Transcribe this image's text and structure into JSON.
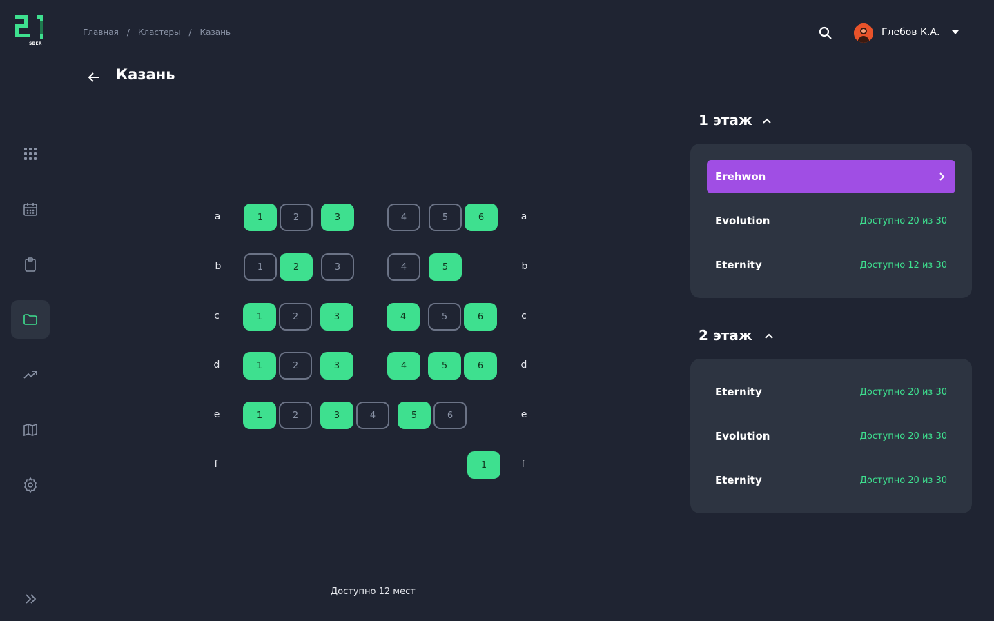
{
  "logo": {
    "sub": "SBER"
  },
  "breadcrumb": {
    "home": "Главная",
    "clusters": "Кластеры",
    "current": "Казань",
    "separator": "/"
  },
  "user": {
    "name": "Глебов К.А."
  },
  "page": {
    "title": "Казань"
  },
  "seatmap": {
    "rows": [
      {
        "label": "a",
        "seats": [
          {
            "n": "1",
            "state": "free"
          },
          {
            "n": "2",
            "state": "busy"
          },
          {
            "n": "3",
            "state": "free"
          },
          {
            "n": "4",
            "state": "busy"
          },
          {
            "n": "5",
            "state": "busy"
          },
          {
            "n": "6",
            "state": "free"
          }
        ]
      },
      {
        "label": "b",
        "seats": [
          {
            "n": "1",
            "state": "busy"
          },
          {
            "n": "2",
            "state": "free"
          },
          {
            "n": "3",
            "state": "busy"
          },
          {
            "n": "4",
            "state": "busy"
          },
          {
            "n": "5",
            "state": "free"
          }
        ]
      },
      {
        "label": "c",
        "seats": [
          {
            "n": "1",
            "state": "free"
          },
          {
            "n": "2",
            "state": "busy"
          },
          {
            "n": "3",
            "state": "free"
          },
          {
            "n": "4",
            "state": "free"
          },
          {
            "n": "5",
            "state": "busy"
          },
          {
            "n": "6",
            "state": "free"
          }
        ]
      },
      {
        "label": "d",
        "seats": [
          {
            "n": "1",
            "state": "free"
          },
          {
            "n": "2",
            "state": "busy"
          },
          {
            "n": "3",
            "state": "free"
          },
          {
            "n": "4",
            "state": "free"
          },
          {
            "n": "5",
            "state": "free"
          },
          {
            "n": "6",
            "state": "free"
          }
        ]
      },
      {
        "label": "e",
        "seats": [
          {
            "n": "1",
            "state": "free"
          },
          {
            "n": "2",
            "state": "busy"
          },
          {
            "n": "3",
            "state": "free"
          },
          {
            "n": "4",
            "state": "busy"
          },
          {
            "n": "5",
            "state": "free"
          },
          {
            "n": "6",
            "state": "busy"
          }
        ]
      },
      {
        "label": "f",
        "seats": [
          {
            "n": "1",
            "state": "free"
          }
        ]
      }
    ],
    "available": "Доступно 12 мест"
  },
  "floors": [
    {
      "title": "1 этаж",
      "clusters": [
        {
          "name": "Erehwon",
          "avail": "",
          "selected": true
        },
        {
          "name": "Evolution",
          "avail": "Доступно 20 из 30",
          "selected": false
        },
        {
          "name": "Eternity",
          "avail": "Доступно 12 из 30",
          "selected": false
        }
      ]
    },
    {
      "title": "2 этаж",
      "clusters": [
        {
          "name": "Eternity",
          "avail": "Доступно 20 из 30",
          "selected": false
        },
        {
          "name": "Evolution",
          "avail": "Доступно 20 из 30",
          "selected": false
        },
        {
          "name": "Eternity",
          "avail": "Доступно 20 из 30",
          "selected": false
        }
      ]
    }
  ],
  "colors": {
    "accent": "#3ee08f",
    "selected": "#a04ee4",
    "background": "#1f2432",
    "card": "#2d3441"
  },
  "icons": {
    "sidebar": [
      "grid-icon",
      "calendar-icon",
      "clipboard-icon",
      "folder-icon",
      "trending-icon",
      "map-icon",
      "gear-icon"
    ],
    "expand": "chevrons-right-icon"
  }
}
